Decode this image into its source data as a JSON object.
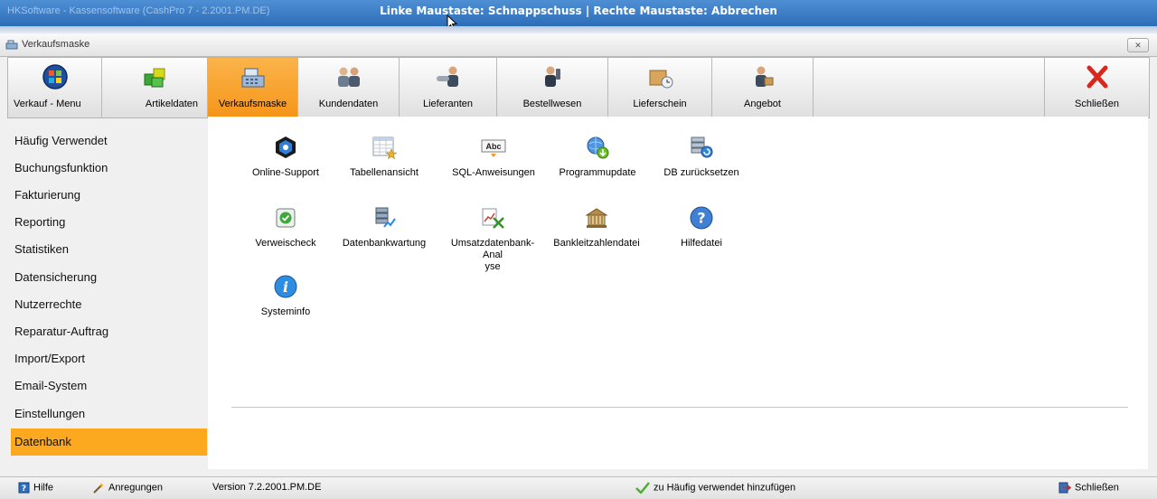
{
  "os_titlebar": {
    "app_title": "HKSoftware - Kassensoftware (CashPro 7 - 2.2001.PM.DE)",
    "capture_hint": "Linke Maustaste: Schnappschuss | Rechte Maustaste: Abbrechen"
  },
  "window": {
    "title": "Verkaufsmaske",
    "close_glyph": "✕"
  },
  "toolbar": {
    "items": [
      {
        "label": "Verkauf - Menu",
        "icon": "windows-orb-icon"
      },
      {
        "label": "Artikeldaten",
        "icon": "cubes-icon"
      },
      {
        "label": "Verkaufsmaske",
        "icon": "cash-register-icon",
        "active": true
      },
      {
        "label": "Kundendaten",
        "icon": "customers-icon"
      },
      {
        "label": "Lieferanten",
        "icon": "supplier-handshake-icon"
      },
      {
        "label": "Bestellwesen",
        "icon": "order-phone-icon"
      },
      {
        "label": "Lieferschein",
        "icon": "delivery-box-clock-icon"
      },
      {
        "label": "Angebot",
        "icon": "offer-person-icon"
      }
    ],
    "close_label": "Schließen"
  },
  "sidebar": {
    "items": [
      {
        "label": "Häufig Verwendet"
      },
      {
        "label": "Buchungsfunktion"
      },
      {
        "label": "Fakturierung"
      },
      {
        "label": "Reporting"
      },
      {
        "label": "Statistiken"
      },
      {
        "label": "Datensicherung"
      },
      {
        "label": "Nutzerrechte"
      },
      {
        "label": "Reparatur-Auftrag"
      },
      {
        "label": "Import/Export"
      },
      {
        "label": "Email-System"
      },
      {
        "label": "Einstellungen"
      },
      {
        "label": "Datenbank",
        "active": true
      }
    ]
  },
  "tiles": [
    {
      "label": "Online-Support",
      "icon": "support-cube-icon"
    },
    {
      "label": "Tabellenansicht",
      "icon": "table-star-icon"
    },
    {
      "label": "SQL-Anweisungen",
      "icon": "abc-sql-icon"
    },
    {
      "label": "Programmupdate",
      "icon": "globe-update-icon"
    },
    {
      "label": "DB zurücksetzen",
      "icon": "database-reset-icon"
    },
    {
      "label": "Verweischeck",
      "icon": "link-check-icon"
    },
    {
      "label": "Datenbankwartung",
      "icon": "database-maintenance-icon"
    },
    {
      "label": "Umsatzdatenbank-Anal\nyse",
      "icon": "sales-analysis-icon"
    },
    {
      "label": "Bankleitzahlendatei",
      "icon": "bank-icon"
    },
    {
      "label": "Hilfedatei",
      "icon": "help-icon"
    },
    {
      "label": "Systeminfo",
      "icon": "info-icon"
    }
  ],
  "statusbar": {
    "help_label": "Hilfe",
    "suggestions_label": "Anregungen",
    "version": "Version 7.2.2001.PM.DE",
    "add_favorite_label": "zu Häufig verwendet hinzufügen",
    "close_label": "Schließen"
  },
  "colors": {
    "accent": "#f7a22c",
    "titlebar": "#3a7cc6"
  }
}
